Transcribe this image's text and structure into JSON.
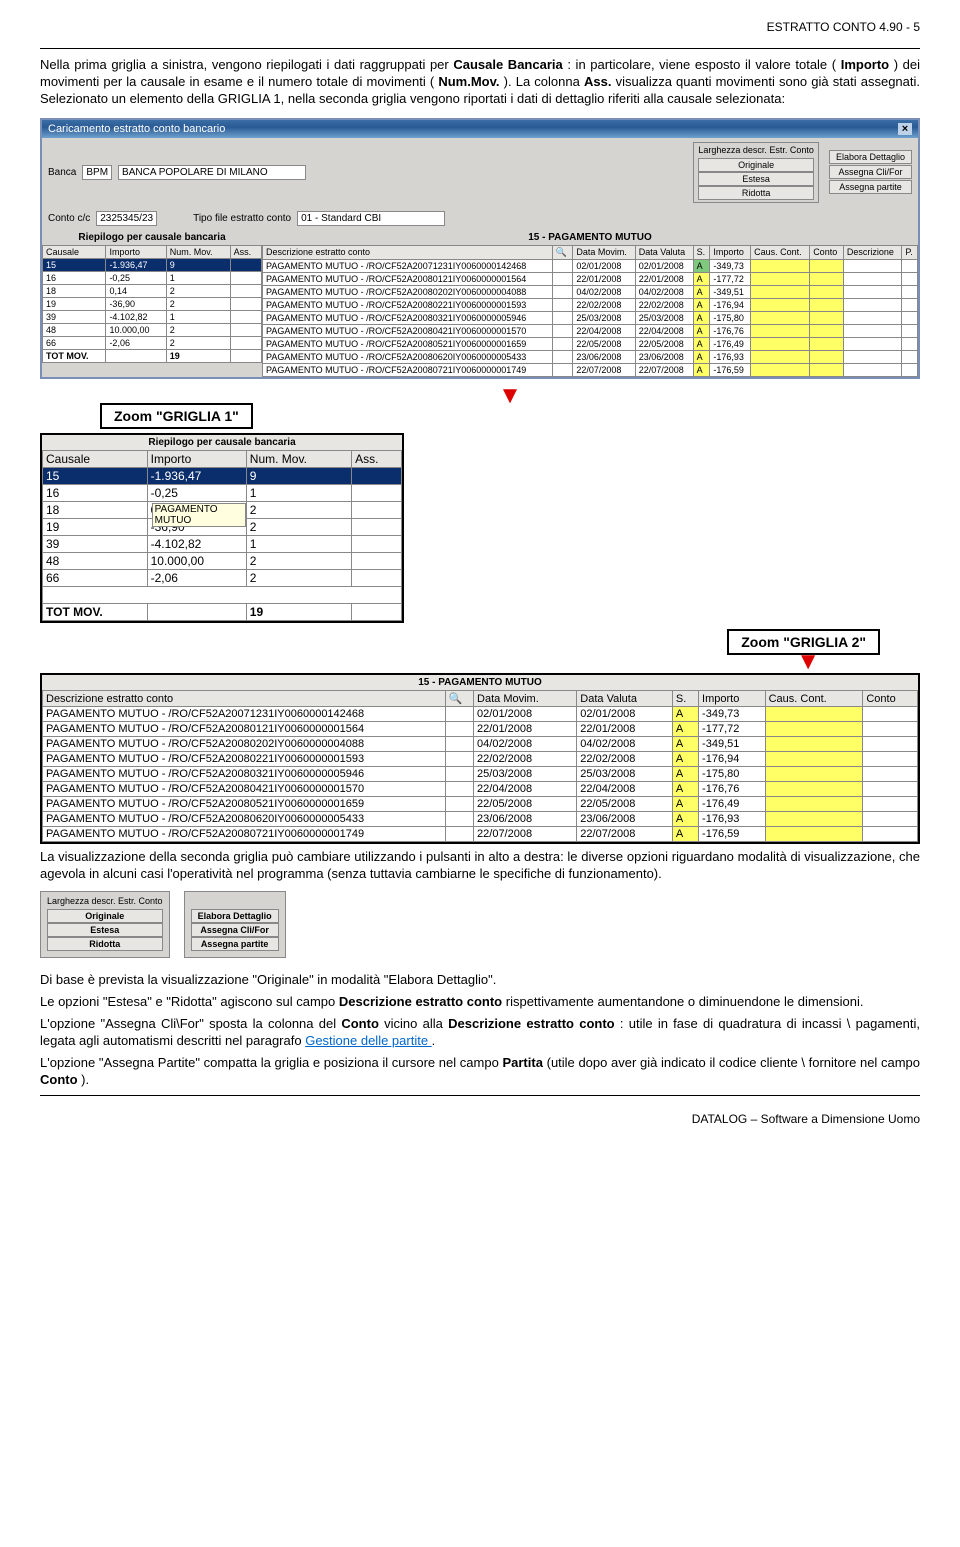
{
  "header": "ESTRATTO CONTO 4.90 - 5",
  "para1_pre": "Nella prima griglia a sinistra, vengono riepilogati i dati raggruppati per ",
  "p1_b1": "Causale Bancaria",
  "p1_mid1": ": in particolare, viene esposto il valore totale (",
  "p1_b2": "Importo",
  "p1_mid2": ") dei movimenti per la causale in esame e il numero totale di movimenti (",
  "p1_b3": "Num.Mov.",
  "p1_mid3": "). La colonna ",
  "p1_b4": "Ass.",
  "p1_mid4": " visualizza quanti movimenti sono già stati assegnati.   Selezionato un elemento della GRIGLIA 1, nella seconda griglia vengono riportati i dati di dettaglio riferiti alla causale selezionata:",
  "app": {
    "title": "Caricamento estratto conto bancario",
    "bank_lbl": "Banca",
    "bank_code": "BPM",
    "bank_name": "BANCA POPOLARE DI MILANO",
    "cc_lbl": "Conto c/c",
    "cc_val": "2325345/23",
    "tipo_lbl": "Tipo file estratto conto",
    "tipo_val": "01 - Standard CBI",
    "box1_title": "Larghezza descr. Estr. Conto",
    "box1_opts": [
      "Originale",
      "Estesa",
      "Ridotta"
    ],
    "box2_opts": [
      "Elabora Dettaglio",
      "Assegna Cli/For",
      "Assegna partite"
    ],
    "g1_title": "Riepilogo per causale bancaria",
    "g1_cols": [
      "Causale",
      "Importo",
      "Num. Mov.",
      "Ass."
    ],
    "g1_rows": [
      {
        "c": "15",
        "i": "-1.936,47",
        "n": "9",
        "a": ""
      },
      {
        "c": "16",
        "i": "-0,25",
        "n": "1",
        "a": ""
      },
      {
        "c": "18",
        "i": "0,14",
        "n": "2",
        "a": ""
      },
      {
        "c": "19",
        "i": "-36,90",
        "n": "2",
        "a": ""
      },
      {
        "c": "39",
        "i": "-4.102,82",
        "n": "1",
        "a": ""
      },
      {
        "c": "48",
        "i": "10.000,00",
        "n": "2",
        "a": ""
      },
      {
        "c": "66",
        "i": "-2,06",
        "n": "2",
        "a": ""
      }
    ],
    "g1_tot": {
      "c": "TOT MOV.",
      "n": "19"
    },
    "g2_title": "15 - PAGAMENTO MUTUO",
    "g2_cols": [
      "Descrizione estratto conto",
      "Data Movim.",
      "Data Valuta",
      "S.",
      "Importo",
      "Caus. Cont.",
      "Conto",
      "Descrizione",
      "P."
    ],
    "g2_rows": [
      {
        "d": "PAGAMENTO MUTUO - /RO/CF52A20071231IY0060000142468",
        "dm": "02/01/2008",
        "dv": "02/01/2008",
        "s": "A",
        "i": "-349,73"
      },
      {
        "d": "PAGAMENTO MUTUO - /RO/CF52A20080121IY0060000001564",
        "dm": "22/01/2008",
        "dv": "22/01/2008",
        "s": "A",
        "i": "-177,72"
      },
      {
        "d": "PAGAMENTO MUTUO - /RO/CF52A20080202IY0060000004088",
        "dm": "04/02/2008",
        "dv": "04/02/2008",
        "s": "A",
        "i": "-349,51"
      },
      {
        "d": "PAGAMENTO MUTUO - /RO/CF52A20080221IY0060000001593",
        "dm": "22/02/2008",
        "dv": "22/02/2008",
        "s": "A",
        "i": "-176,94"
      },
      {
        "d": "PAGAMENTO MUTUO - /RO/CF52A20080321IY0060000005946",
        "dm": "25/03/2008",
        "dv": "25/03/2008",
        "s": "A",
        "i": "-175,80"
      },
      {
        "d": "PAGAMENTO MUTUO - /RO/CF52A20080421IY0060000001570",
        "dm": "22/04/2008",
        "dv": "22/04/2008",
        "s": "A",
        "i": "-176,76"
      },
      {
        "d": "PAGAMENTO MUTUO - /RO/CF52A20080521IY0060000001659",
        "dm": "22/05/2008",
        "dv": "22/05/2008",
        "s": "A",
        "i": "-176,49"
      },
      {
        "d": "PAGAMENTO MUTUO - /RO/CF52A20080620IY0060000005433",
        "dm": "23/06/2008",
        "dv": "23/06/2008",
        "s": "A",
        "i": "-176,93"
      },
      {
        "d": "PAGAMENTO MUTUO - /RO/CF52A20080721IY0060000001749",
        "dm": "22/07/2008",
        "dv": "22/07/2008",
        "s": "A",
        "i": "-176,59"
      }
    ]
  },
  "zoom1": "Zoom \"GRIGLIA 1\"",
  "zoom2": "Zoom \"GRIGLIA 2\"",
  "g1_tooltip": "PAGAMENTO MUTUO",
  "para2": "La visualizzazione della seconda griglia può cambiare utilizzando i pulsanti in alto a destra: le diverse opzioni riguardano modalità di visualizzazione, che agevola in alcuni casi l'operatività nel programma (senza tuttavia cambiarne le specifiche di funzionamento).",
  "para3": "Di base è prevista la visualizzazione \"Originale\" in modalità \"Elabora Dettaglio\".",
  "para4_pre": "Le opzioni \"Estesa\" e \"Ridotta\" agiscono sul campo ",
  "p4_b1": "Descrizione estratto conto",
  "p4_tail": " rispettivamente aumentandone o diminuendone le dimensioni.",
  "para5_pre": "L'opzione \"Assegna Cli\\For\" sposta la colonna del ",
  "p5_b1": "Conto",
  "p5_mid": " vicino alla ",
  "p5_b2": "Descrizione estratto conto",
  "p5_tail1": ": utile in fase di quadratura di incassi \\ pagamenti, legata agli automatismi descritti nel paragrafo ",
  "p5_link": "Gestione delle partite ",
  "p5_tail2": ".",
  "para6_pre": "L'opzione \"Assegna Partite\" compatta la griglia e posiziona il cursore nel campo ",
  "p6_b1": "Partita",
  "p6_mid": " (utile dopo aver già indicato il codice cliente \\ fornitore nel campo ",
  "p6_b2": "Conto",
  "p6_tail": ").",
  "footer": "DATALOG – Software a Dimensione Uomo"
}
